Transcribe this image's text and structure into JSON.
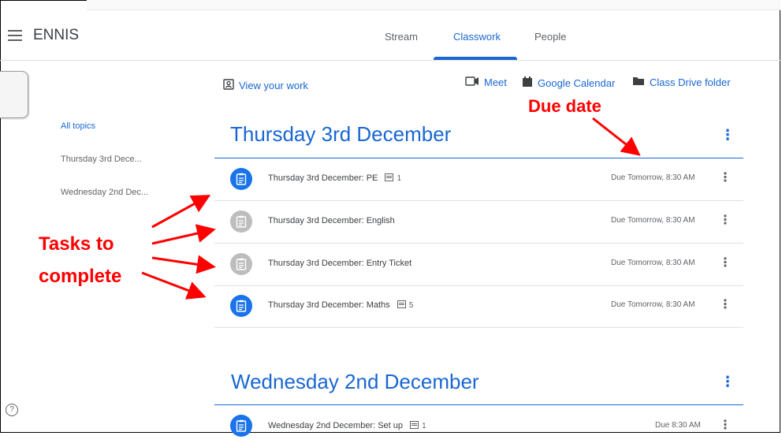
{
  "header": {
    "class_name": "ENNIS",
    "tabs": [
      {
        "label": "Stream"
      },
      {
        "label": "Classwork"
      },
      {
        "label": "People"
      }
    ]
  },
  "toolbar": {
    "view_work": "View your work",
    "meet": "Meet",
    "calendar": "Google Calendar",
    "drive": "Class Drive folder"
  },
  "sidebar": {
    "items": [
      {
        "label": "All topics"
      },
      {
        "label": "Thursday 3rd Dece..."
      },
      {
        "label": "Wednesday 2nd Dec..."
      }
    ]
  },
  "topics": [
    {
      "title": "Thursday 3rd December",
      "assignments": [
        {
          "title": "Thursday 3rd December: PE",
          "comments": "1",
          "due": "Due Tomorrow, 8:30 AM"
        },
        {
          "title": "Thursday 3rd December: English",
          "comments": "",
          "due": "Due Tomorrow, 8:30 AM"
        },
        {
          "title": "Thursday 3rd December: Entry Ticket",
          "comments": "",
          "due": "Due Tomorrow, 8:30 AM"
        },
        {
          "title": "Thursday 3rd December: Maths",
          "comments": "5",
          "due": "Due Tomorrow, 8:30 AM"
        }
      ]
    },
    {
      "title": "Wednesday 2nd December",
      "assignments": [
        {
          "title": "Wednesday 2nd December: Set up",
          "comments": "1",
          "due": "Due 8:30 AM"
        }
      ]
    }
  ],
  "annotations": {
    "due_date": "Due date",
    "tasks_line1": "Tasks to",
    "tasks_line2": "complete"
  },
  "colors": {
    "accent": "#1967d2",
    "annotation": "#ff0000",
    "icon_active": "#1a73e8",
    "icon_inactive": "#bdbdbd"
  },
  "icons": {
    "menu": "menu-icon",
    "assignment": "assignment-icon",
    "more": "more-vert-icon",
    "help": "help-icon"
  }
}
